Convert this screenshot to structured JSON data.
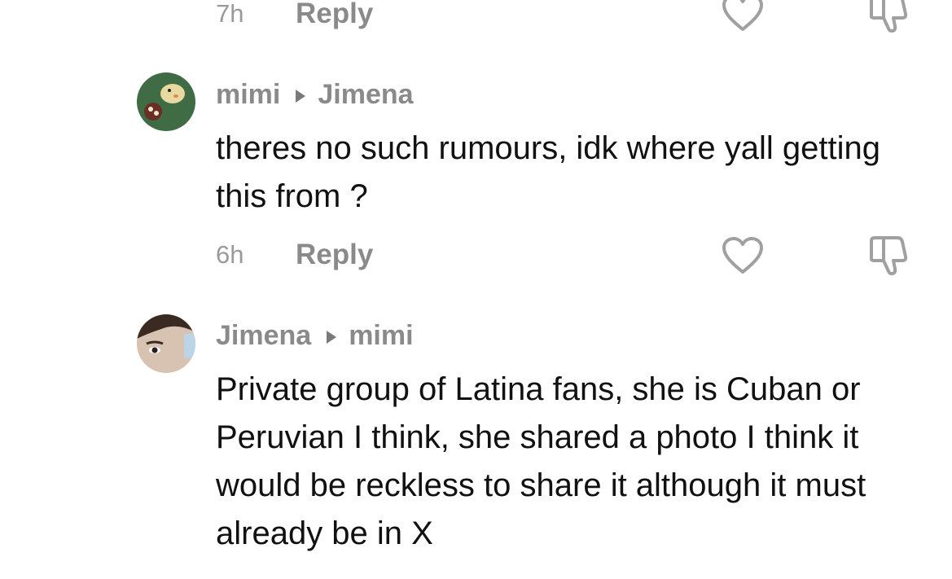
{
  "thread": {
    "top_meta": {
      "time": "7h",
      "reply_label": "Reply"
    },
    "comments": [
      {
        "author": "mimi",
        "reply_to": "Jimena",
        "text": "theres no such rumours, idk where yall getting this from ?",
        "time": "6h",
        "reply_label": "Reply"
      },
      {
        "author": "Jimena",
        "reply_to": "mimi",
        "text": "Private group of Latina fans, she is Cuban or Peruvian I think, she shared a photo I think it would be reckless to share it although it must already be in X"
      }
    ]
  },
  "icons": {
    "like": "heart-outline-icon",
    "dislike": "thumbs-down-outline-icon",
    "reply_arrow": "play-triangle-icon"
  },
  "colors": {
    "text": "#111111",
    "meta": "#8a8a8a",
    "icon_stroke": "#a0a0a0"
  }
}
